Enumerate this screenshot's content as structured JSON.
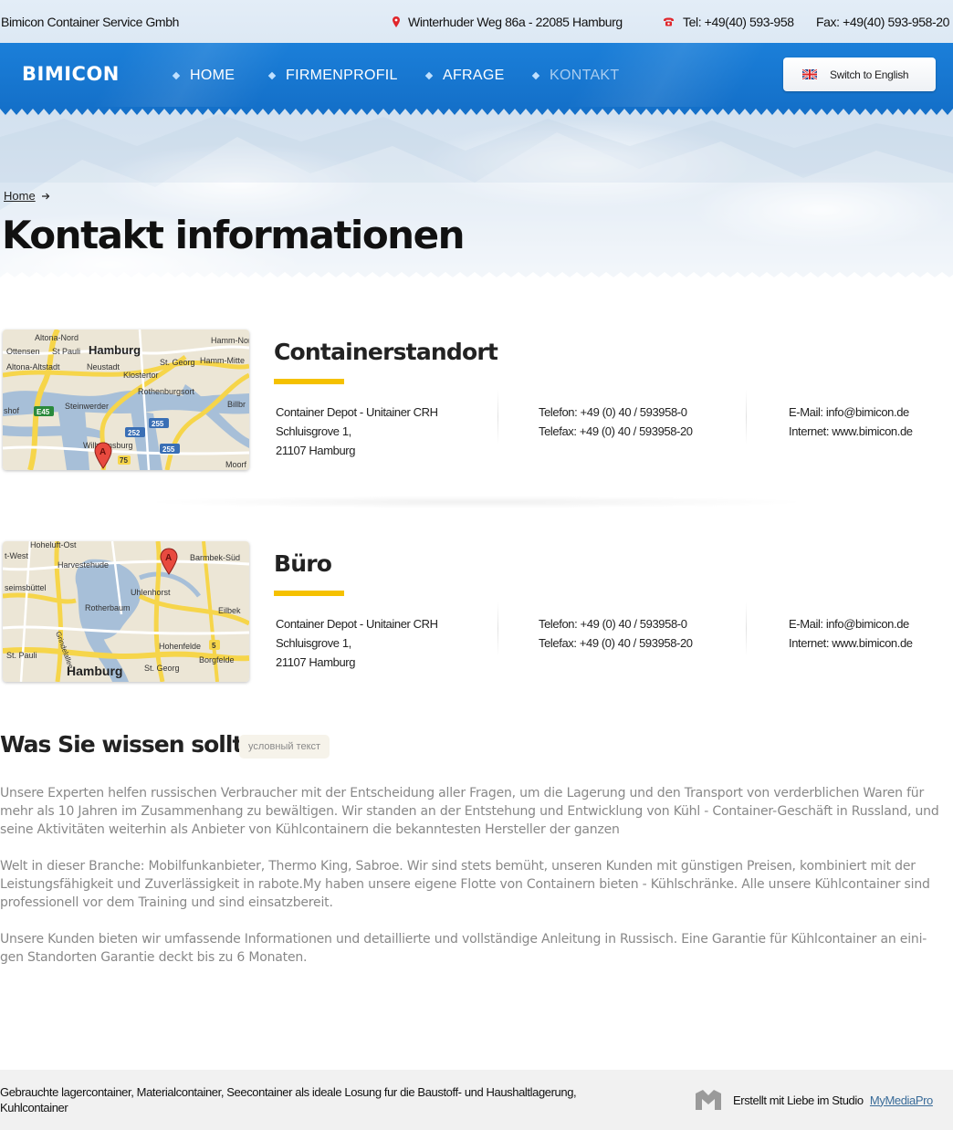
{
  "topbar": {
    "company": "Bimicon Container Service Gmbh",
    "address": "Winterhuder Weg 86a - 22085 Hamburg",
    "tel": "Tel: +49(40) 593-958",
    "fax": "Fax: +49(40) 593-958-20",
    "address_icon": "map-pin-icon",
    "tel_icon": "phone-icon"
  },
  "nav": {
    "logo": "BIMICON",
    "items": [
      {
        "label": "HOME"
      },
      {
        "label": "FIRMENPROFIL"
      },
      {
        "label": "AFRAGE"
      },
      {
        "label": "KONTAKT",
        "active": true
      }
    ],
    "lang_button": "Switch to English",
    "lang_icon": "uk-flag-icon"
  },
  "breadcrumb": {
    "home": "Home",
    "separator_icon": "arrow-right-icon"
  },
  "page_title": "Kontakt informationen",
  "locations": [
    {
      "title": "Containerstandort",
      "address": [
        "Container Depot - Unitainer CRH",
        "Schluisgrove 1,",
        "21107 Hamburg"
      ],
      "phone": [
        "Telefon: +49 (0) 40 / 593958-0",
        "Telefax: +49 (0) 40 / 593958-20"
      ],
      "web": [
        "E-Mail: info@bimicon.de",
        "Internet: www.bimicon.de"
      ],
      "map_labels": [
        "Altona-Nord",
        "Hamburg",
        "Ottensen",
        "St Pauli",
        "Altona-Altstadt",
        "Neustadt",
        "Klostertor",
        "St. Georg",
        "Hamm-Mitte",
        "Rothenburgsort",
        "Steinwerder",
        "Billbr",
        "E45",
        "252",
        "255",
        "255",
        "Wilhelmsburg",
        "75",
        "Moorf",
        "shof",
        "Hamm-Nord"
      ]
    },
    {
      "title": "Büro",
      "address": [
        "Container Depot - Unitainer CRH",
        "Schluisgrove 1,",
        "21107 Hamburg"
      ],
      "phone": [
        "Telefon: +49 (0) 40 / 593958-0",
        "Telefax: +49 (0) 40 / 593958-20"
      ],
      "web": [
        "E-Mail: info@bimicon.de",
        "Internet: www.bimicon.de"
      ],
      "map_labels": [
        "Hoheluft-Ost",
        "t-West",
        "Harvestehude",
        "Barmbek-Süd",
        "seimsbüttel",
        "Uhlenhorst",
        "Rotherbaum",
        "Eilbek",
        "Hohenfelde",
        "5",
        "St. Pauli",
        "Borgfelde",
        "Hamburg",
        "St. Georg",
        "Grindelallee"
      ]
    }
  ],
  "info": {
    "title": "Was Sie wissen sollten",
    "badge": "условный текст",
    "paragraphs": [
      "Unsere Experten helfen russischen Verbraucher mit der Entscheidung aller Fragen, um die Lagerung und den Transport von verderblichen Waren für mehr als 10 Jahren im Zusammenhang zu bewältigen. Wir standen an der Entstehung und Entwicklung von Kühl - Container-Geschäft in Russland, und seine Aktivitäten weiterhin als Anbieter von Kühlcontainern die bekanntesten Hersteller der ganzen",
      "Welt in dieser Branche: Mobilfunkanbieter, Thermo King, Sabroe. Wir sind stets bemüht, unseren Kunden mit günstigen Preisen, kombiniert mit der Leistungsfähigkeit und Zuverlässigkeit in rabote.My haben unsere eigene Flotte von Containern bieten - Kühlschränke. Alle unsere Kühlcontainer sind professionell vor dem Training und sind einsatzbereit.",
      "Unsere Kunden bieten wir umfassende Informationen und detaillierte und vollständige Anleitung in Russisch. Eine Garantie für Kühlcontainer an eini- gen Standorten Garantie deckt bis zu 6 Monaten."
    ]
  },
  "footer": {
    "text": "Gebrauchte lagercontainer, Materialcontainer, Seecontainer als ideale Losung fur die Baustoff- und Haushaltlagerung, Kuhlcontainer",
    "credit": "Erstellt mit Liebe im Studio",
    "credit_link": "MyMediaPro",
    "credit_icon": "mymediapro-logo-icon"
  },
  "colors": {
    "nav_blue": "#1778d2",
    "accent_yellow": "#f5c100",
    "footer_bg": "#f1f1f1",
    "body_text_grey": "#888888"
  }
}
